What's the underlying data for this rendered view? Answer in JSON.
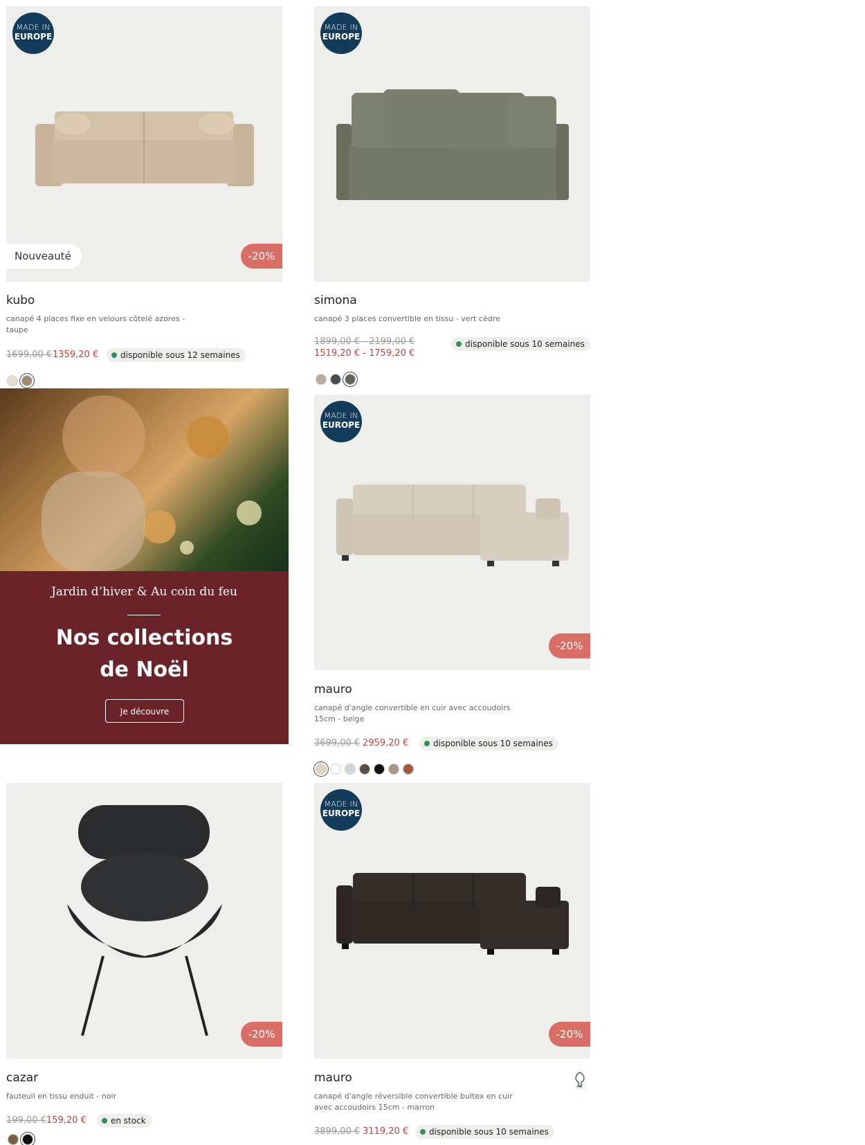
{
  "badge_made_in": {
    "line1": "MADE IN",
    "line2": "EUROPE"
  },
  "products": [
    {
      "name": "kubo",
      "description": "canapé 4 places fixe en velours côtelé azores - taupe",
      "price_old": "1699,00 €",
      "price_new": "1359,20 €",
      "availability": "disponible sous 12 semaines",
      "tag_new": "Nouveauté",
      "discount": "-20%",
      "swatches": [
        "#e7dccd",
        "#9d8a72"
      ]
    },
    {
      "name": "simona",
      "description": "canapé 3 places convertible en tissu - vert cèdre",
      "price_old": "1899,00 € - 2199,00 €",
      "price_new": "1519,20 € - 1759,20 €",
      "availability": "disponible sous 10 semaines",
      "swatches": [
        "#b6ada0",
        "#4a4d52",
        "#5f6559"
      ]
    },
    {
      "name": "mauro",
      "description": "canapé d'angle convertible en cuir avec accoudoirs 15cm - beige",
      "price_old": "3699,00 €",
      "price_new": "2959,20 €",
      "availability": "disponible sous 10 semaines",
      "discount": "-20%",
      "swatches": [
        "#ddd3c3",
        "#ffffff",
        "#cfd8dc",
        "#5b4f45",
        "#111111",
        "#a99888",
        "#a45b3a"
      ]
    },
    {
      "name": "cazar",
      "description": "fauteuil en tissu enduit - noir",
      "price_old": "199,00 €",
      "price_new": "159,20 €",
      "availability": "en stock",
      "discount": "-20%",
      "swatches": [
        "#7a5f44",
        "#111111"
      ]
    },
    {
      "name": "mauro",
      "description": "canapé d'angle réversible convertible bultex en cuir avec accoudoirs 15cm - marron",
      "price_old": "3899,00 €",
      "price_new": "3119,20 €",
      "availability": "disponible sous 10 semaines",
      "discount": "-20%"
    }
  ],
  "promo": {
    "subtitle": "Jardin d’hiver & Au coin du feu",
    "title_line1": "Nos collections",
    "title_line2": "de Noël",
    "button": "Je découvre"
  },
  "colors": {
    "made_in_badge": "#123c59",
    "discount": "#d96e66",
    "sale_price": "#c2423b",
    "promo_panel": "#6a2429",
    "availability_dot": "#2f8f5f"
  },
  "icons": [
    "fsc-tree-icon"
  ]
}
